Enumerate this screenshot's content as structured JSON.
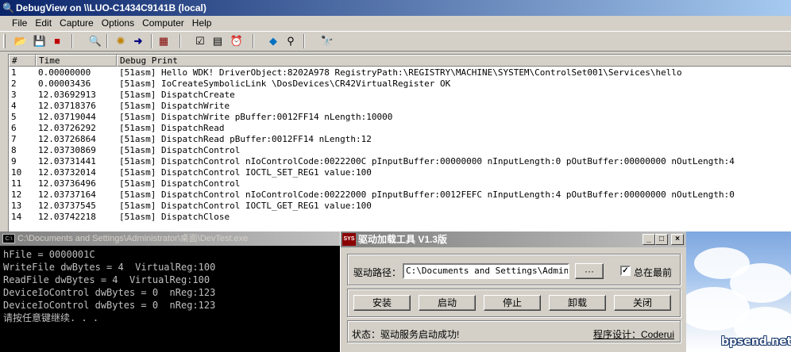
{
  "debugview": {
    "title": "DebugView on \\\\LUO-C1434C9141B (local)",
    "menu": [
      "File",
      "Edit",
      "Capture",
      "Options",
      "Computer",
      "Help"
    ],
    "toolbar_icons": [
      "open-icon",
      "save-icon",
      "clear-icon",
      "find-icon",
      "capture-icon",
      "autoscroll-icon",
      "highlight-icon",
      "filter-icon",
      "history-icon",
      "clock-icon",
      "properties-icon",
      "hide-icon",
      "find-next-icon"
    ],
    "columns": [
      "#",
      "Time",
      "Debug Print"
    ],
    "rows": [
      {
        "n": "1",
        "time": "0.00000000",
        "msg": "[51asm] Hello WDK! DriverObject:8202A978 RegistryPath:\\REGISTRY\\MACHINE\\SYSTEM\\ControlSet001\\Services\\hello"
      },
      {
        "n": "2",
        "time": "0.00003436",
        "msg": "[51asm] IoCreateSymbolicLink \\DosDevices\\CR42VirtualRegister OK"
      },
      {
        "n": "3",
        "time": "12.03692913",
        "msg": "[51asm] DispatchCreate"
      },
      {
        "n": "4",
        "time": "12.03718376",
        "msg": "[51asm] DispatchWrite"
      },
      {
        "n": "5",
        "time": "12.03719044",
        "msg": "[51asm] DispatchWrite pBuffer:0012FF14 nLength:10000"
      },
      {
        "n": "6",
        "time": "12.03726292",
        "msg": "[51asm] DispatchRead"
      },
      {
        "n": "7",
        "time": "12.03726864",
        "msg": "[51asm] DispatchRead pBuffer:0012FF14 nLength:12"
      },
      {
        "n": "8",
        "time": "12.03730869",
        "msg": "[51asm] DispatchControl"
      },
      {
        "n": "9",
        "time": "12.03731441",
        "msg": "[51asm] DispatchControl nIoControlCode:0022200C pInputBuffer:00000000 nInputLength:0 pOutBuffer:00000000 nOutLength:4"
      },
      {
        "n": "10",
        "time": "12.03732014",
        "msg": "[51asm] DispatchControl IOCTL_SET_REG1 value:100"
      },
      {
        "n": "11",
        "time": "12.03736496",
        "msg": "[51asm] DispatchControl"
      },
      {
        "n": "12",
        "time": "12.03737164",
        "msg": "[51asm] DispatchControl nIoControlCode:00222000 pInputBuffer:0012FEFC nInputLength:4 pOutBuffer:00000000 nOutLength:0"
      },
      {
        "n": "13",
        "time": "12.03737545",
        "msg": "[51asm] DispatchControl IOCTL_GET_REG1 value:100"
      },
      {
        "n": "14",
        "time": "12.03742218",
        "msg": "[51asm] DispatchClose"
      }
    ]
  },
  "console": {
    "icon_text": "C:\\",
    "title": "C:\\Documents and Settings\\Administrator\\桌面\\DevTest.exe",
    "lines": [
      "hFile = 0000001C",
      "WriteFile dwBytes = 4  VirtualReg:100",
      "ReadFile dwBytes = 4  VirtualReg:100",
      "DeviceIoControl dwBytes = 0  nReg:123",
      "DeviceIoControl dwBytes = 0  nReg:123",
      "请按任意键继续. . ."
    ]
  },
  "loader": {
    "icon_text": "SYS",
    "title": "驱动加载工具 V1.3版",
    "path_label": "驱动路径：",
    "path_value": "C:\\Documents and Settings\\Administ",
    "browse_label": "···",
    "topmost_label": "总在最前",
    "topmost_check": "✓",
    "buttons": {
      "install": "安装",
      "start": "启动",
      "stop": "停止",
      "uninstall": "卸载",
      "close": "关闭"
    },
    "status": "状态：驱动服务启动成功!",
    "credit": "程序设计：Coderui"
  },
  "watermark": "bpsend.net"
}
